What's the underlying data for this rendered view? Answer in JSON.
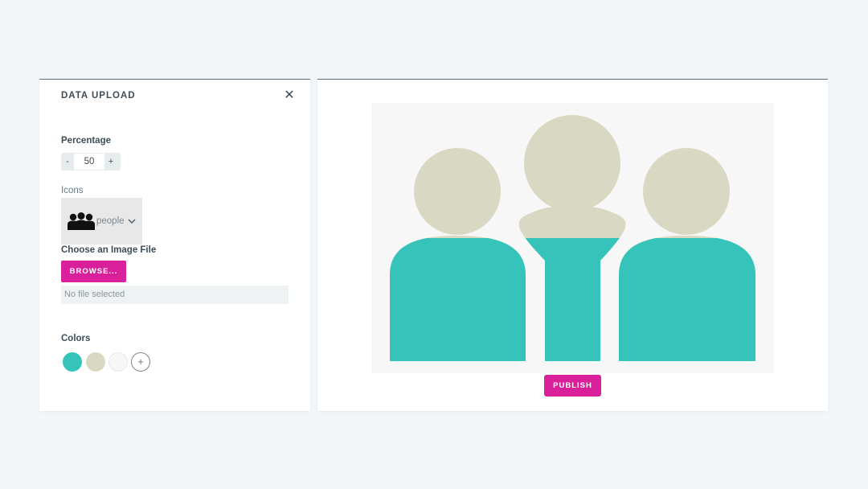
{
  "panel": {
    "title": "DATA UPLOAD",
    "close_icon": "close-icon"
  },
  "percentage": {
    "label": "Percentage",
    "decrement": "-",
    "value": "50",
    "increment": "+"
  },
  "icons": {
    "label": "Icons",
    "selected_icon": "people-icon",
    "selected_label": "people"
  },
  "image_file": {
    "label": "Choose an Image File",
    "browse_label": "BROWSE...",
    "status": "No file selected"
  },
  "colors": {
    "label": "Colors",
    "swatches": [
      "#36c3b9",
      "#d9d9c3",
      "#f7f7f7"
    ],
    "add_label": "+"
  },
  "preview": {
    "fill_percentage": 50,
    "base_color": "#d9d9c3",
    "fill_color": "#36c3b9",
    "background": "#f7f7f7"
  },
  "publish_label": "PUBLISH"
}
